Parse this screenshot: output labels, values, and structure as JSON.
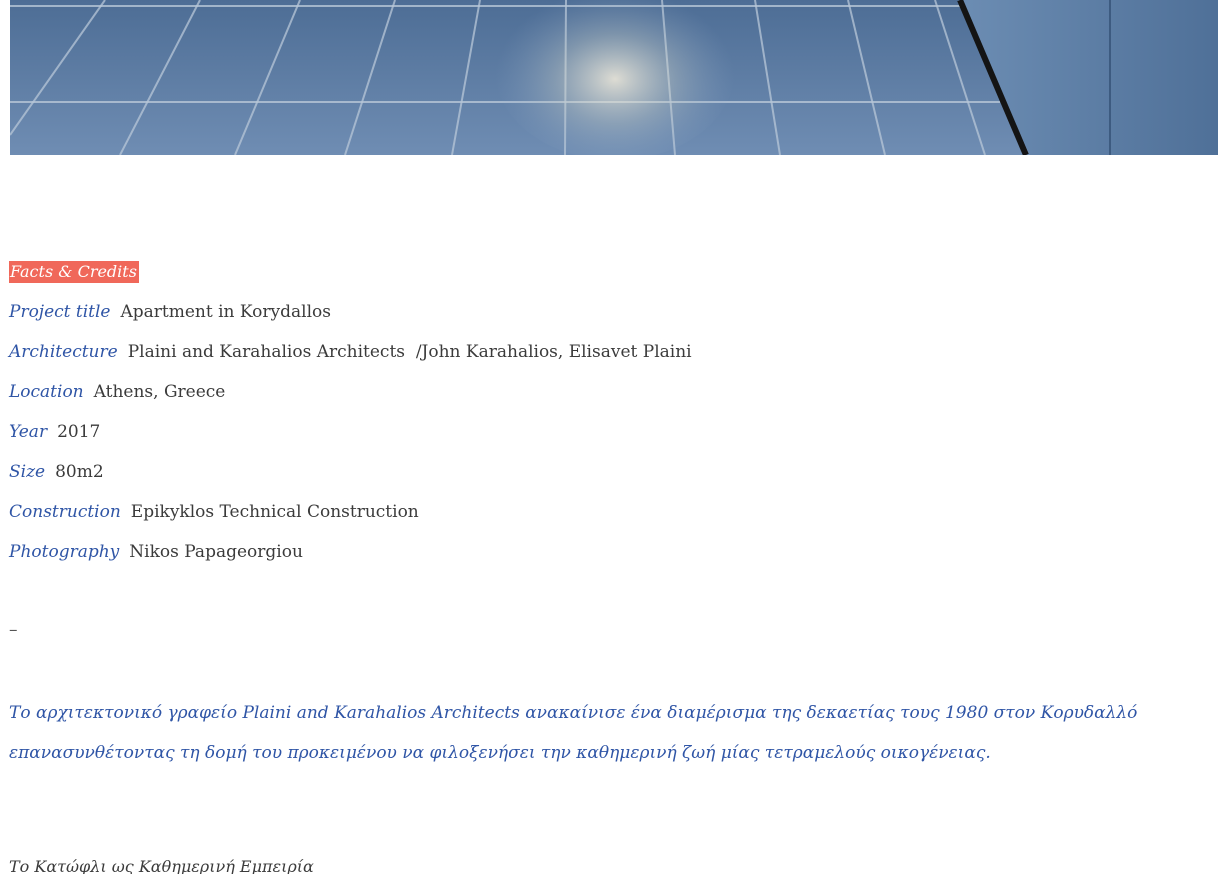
{
  "hero": {
    "photo_colors": {
      "tile_light": "#8ea7c6",
      "tile_dark": "#3f5f86",
      "grout": "#b8c7d8",
      "wall": "#5c7ea6",
      "edge": "#1a1a1a"
    }
  },
  "facts": {
    "heading": "Facts & Credits",
    "rows": [
      {
        "label": "Project title",
        "value": "Apartment in Korydallos"
      },
      {
        "label": "Architecture",
        "value": "Plaini and Karahalios Architects  /John Karahalios, Elisavet Plaini"
      },
      {
        "label": "Location",
        "value": "Athens, Greece"
      },
      {
        "label": "Year",
        "value": "2017"
      },
      {
        "label": "Size",
        "value": "80m2"
      },
      {
        "label": "Construction",
        "value": "Epikyklos Technical Construction"
      },
      {
        "label": "Photography",
        "value": "Nikos Papageorgiou"
      }
    ],
    "heading_color": "#f0685a",
    "label_color": "#2f55a6"
  },
  "separator": "–",
  "intro": "Το αρχιτεκτονικό γραφείο  Plaini and Karahalios Architects ανακαίνισε ένα διαμέρισμα της δεκαετίας τους 1980 στον Κορυδαλλό επανασυνθέτοντας τη δομή του προκειμένου να φιλοξενήσει την καθημερινή ζωή μίας τετραμελούς οικογένειας.",
  "subheading": "Το Κατώφλι ως Καθημερινή Εμπειρία"
}
